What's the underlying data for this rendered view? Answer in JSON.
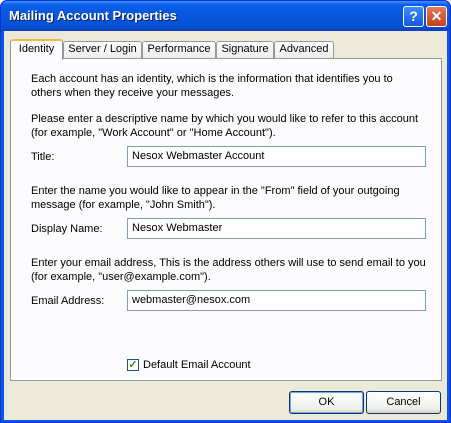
{
  "window": {
    "title": "Mailing Account Properties",
    "help_glyph": "?",
    "close_glyph": "✕"
  },
  "tabs": [
    {
      "label": "Identity"
    },
    {
      "label": "Server / Login"
    },
    {
      "label": "Performance"
    },
    {
      "label": "Signature"
    },
    {
      "label": "Advanced"
    }
  ],
  "identity": {
    "intro_line1": "Each account has an identity, which is the information that identifies you to",
    "intro_line2": "others when they receive your messages.",
    "title_help_line1": "Please enter a descriptive name by which you would like to refer to this account",
    "title_help_line2": "(for example, \"Work Account\" or \"Home Account\").",
    "title_label": "Title:",
    "title_value": "Nesox Webmaster Account",
    "display_help_line1": "Enter the name you would like to appear in the \"From\" field of your outgoing",
    "display_help_line2": "message (for example, \"John Smith\").",
    "display_label": "Display Name:",
    "display_value": "Nesox Webmaster",
    "email_help_line1": "Enter your email address, This is the address others will use to send email to you",
    "email_help_line2": "(for example, \"user@example.com\").",
    "email_label": "Email Address:",
    "email_value": "webmaster@nesox.com",
    "default_label": "Default Email Account",
    "default_checked": true,
    "check_glyph": "✓"
  },
  "buttons": {
    "ok": "OK",
    "cancel": "Cancel"
  }
}
